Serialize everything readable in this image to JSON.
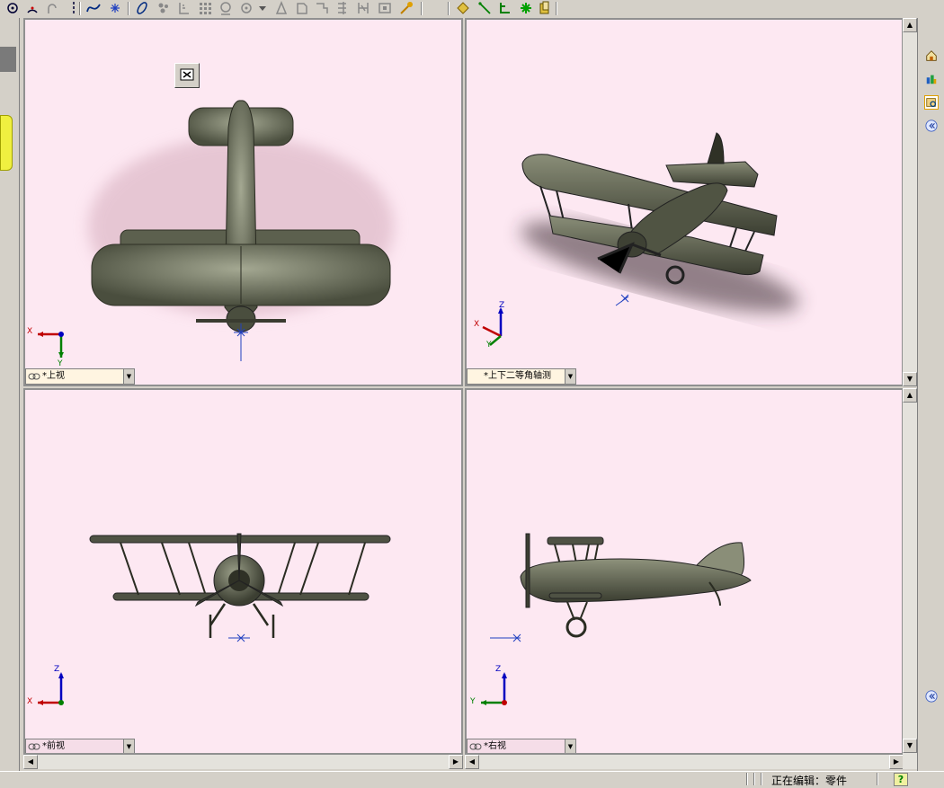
{
  "toolbar": {
    "icons": [
      "sketch-point-icon",
      "arc-icon",
      "tangent-arc-icon",
      "centerline-icon",
      "spline-icon",
      "point-icon",
      "ellipse-icon",
      "smart-dimension-icon",
      "linear-pattern-icon",
      "mirror-icon",
      "offset-icon",
      "convert-icon",
      "trim-icon",
      "extend-icon",
      "move-icon",
      "rotate-icon",
      "copy-icon",
      "planar-icon",
      "line-icon",
      "relation-icon",
      "display-relation-icon",
      "repair-icon"
    ]
  },
  "viewports": [
    {
      "id": "top",
      "label": "*上视"
    },
    {
      "id": "iso",
      "label": "*上下二等角轴测"
    },
    {
      "id": "front",
      "label": "*前视"
    },
    {
      "id": "right",
      "label": "*右视"
    }
  ],
  "triad": {
    "x": "X",
    "y": "Y",
    "z": "Z"
  },
  "statusbar": {
    "editing": "正在编辑：零件",
    "help": "?"
  },
  "colors": {
    "viewport_bg": "#fde8f2",
    "model": "#4f5244",
    "axis_x": "#c00000",
    "axis_y": "#008000",
    "axis_z": "#0000c0"
  }
}
